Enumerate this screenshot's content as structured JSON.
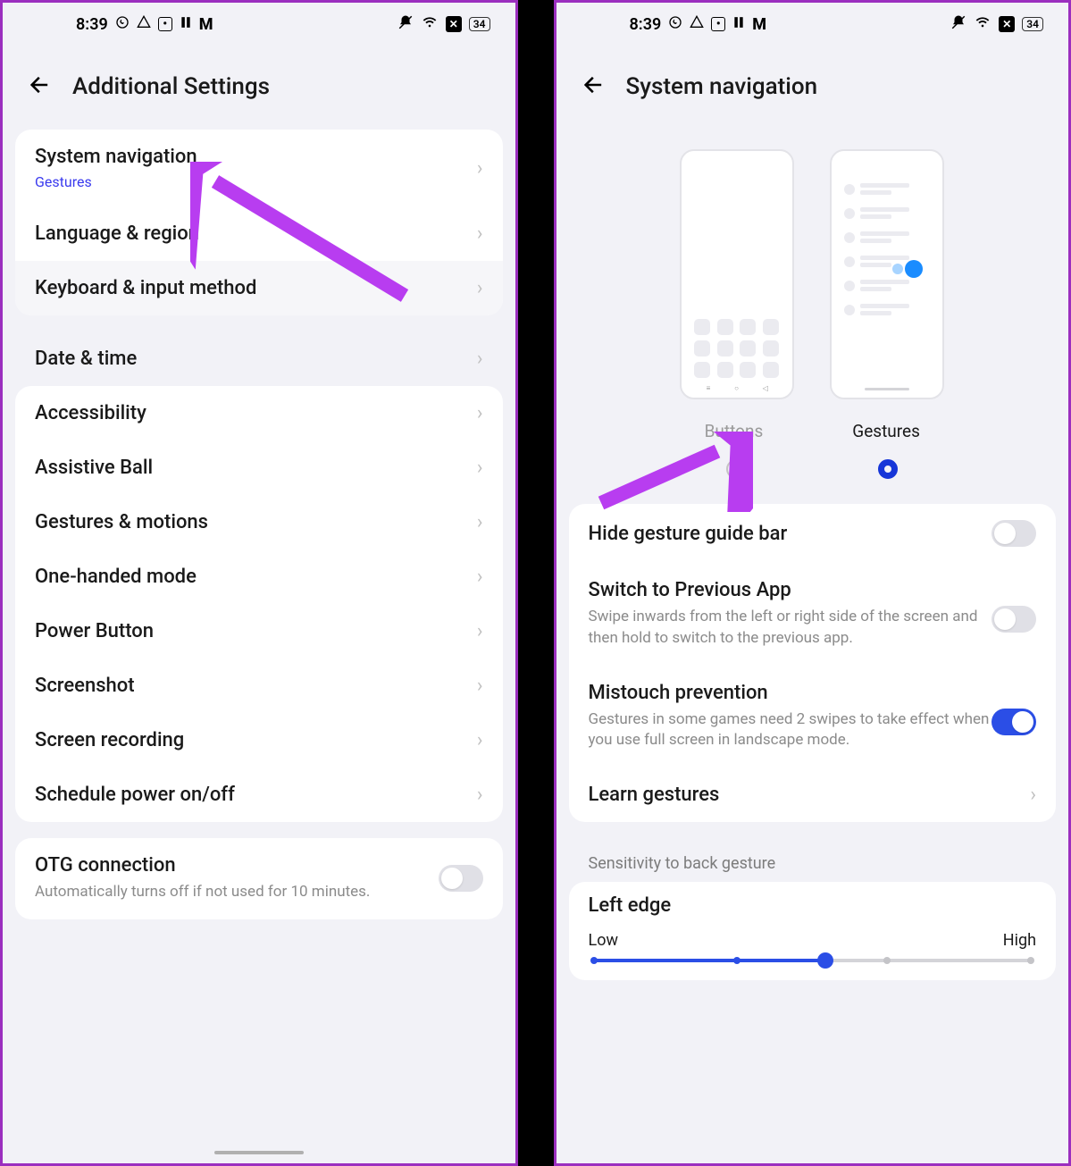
{
  "status": {
    "time": "8:39",
    "battery": "34"
  },
  "left": {
    "title": "Additional Settings",
    "group1": {
      "navigation": {
        "title": "System navigation",
        "sub": "Gestures"
      },
      "language": "Language & region",
      "keyboard": "Keyboard & input method"
    },
    "datetime": "Date & time",
    "group2": [
      "Accessibility",
      "Assistive Ball",
      "Gestures & motions",
      "One-handed mode",
      "Power Button",
      "Screenshot",
      "Screen recording",
      "Schedule power on/off"
    ],
    "otg": {
      "title": "OTG connection",
      "desc": "Automatically turns off if not used for 10 minutes."
    }
  },
  "right": {
    "title": "System navigation",
    "options": {
      "buttons": "Buttons",
      "gestures": "Gestures"
    },
    "hideBar": "Hide gesture guide bar",
    "switchPrev": {
      "title": "Switch to Previous App",
      "desc": "Swipe inwards from the left or right side of the screen and then hold to switch to the previous app."
    },
    "mistouch": {
      "title": "Mistouch prevention",
      "desc": "Gestures in some games need 2 swipes to take effect when you use full screen in landscape mode."
    },
    "learn": "Learn gestures",
    "sensitivity": "Sensitivity to back gesture",
    "leftEdge": {
      "title": "Left edge",
      "low": "Low",
      "high": "High"
    }
  }
}
